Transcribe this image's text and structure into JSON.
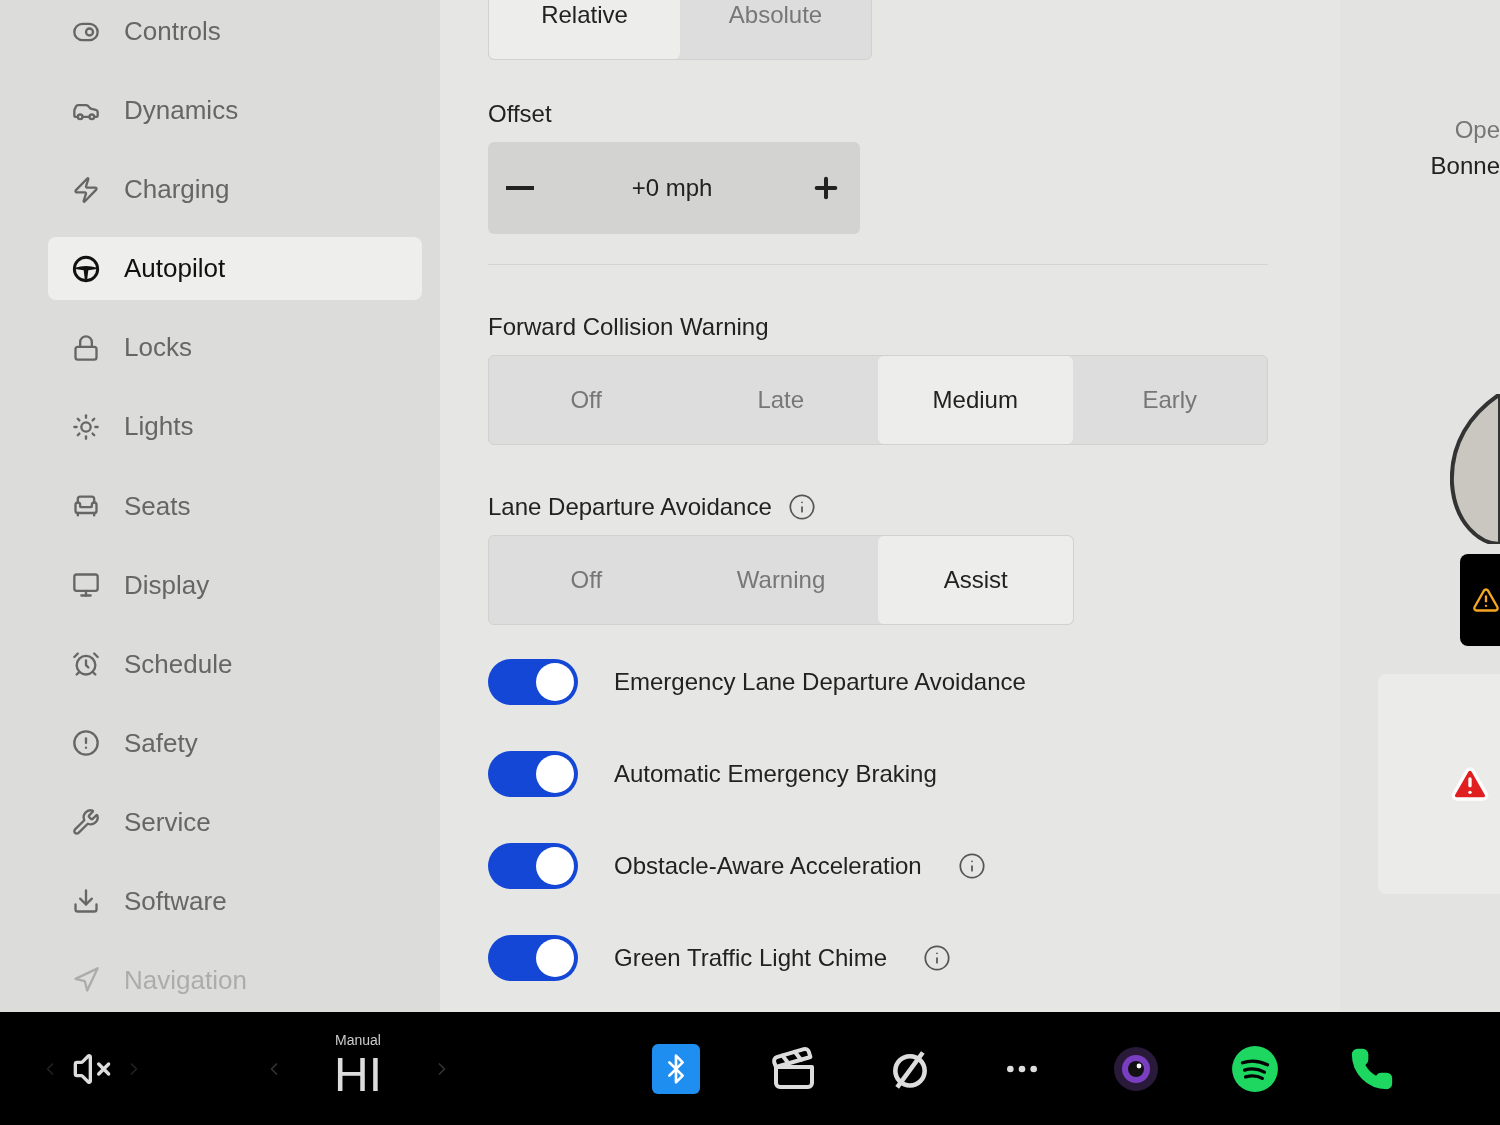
{
  "sidebar": {
    "items": [
      {
        "label": "Controls",
        "selected": false
      },
      {
        "label": "Dynamics",
        "selected": false
      },
      {
        "label": "Charging",
        "selected": false
      },
      {
        "label": "Autopilot",
        "selected": true
      },
      {
        "label": "Locks",
        "selected": false
      },
      {
        "label": "Lights",
        "selected": false
      },
      {
        "label": "Seats",
        "selected": false
      },
      {
        "label": "Display",
        "selected": false
      },
      {
        "label": "Schedule",
        "selected": false
      },
      {
        "label": "Safety",
        "selected": false
      },
      {
        "label": "Service",
        "selected": false
      },
      {
        "label": "Software",
        "selected": false
      },
      {
        "label": "Navigation",
        "selected": false
      }
    ]
  },
  "speed_mode": {
    "options": [
      {
        "label": "Relative",
        "selected": true
      },
      {
        "label": "Absolute",
        "selected": false
      }
    ]
  },
  "offset": {
    "title": "Offset",
    "value": "+0 mph"
  },
  "forward_collision_warning": {
    "title": "Forward Collision Warning",
    "info": false,
    "options": [
      {
        "label": "Off",
        "selected": false
      },
      {
        "label": "Late",
        "selected": false
      },
      {
        "label": "Medium",
        "selected": true
      },
      {
        "label": "Early",
        "selected": false
      }
    ]
  },
  "lane_departure_avoidance": {
    "title": "Lane Departure Avoidance",
    "info": true,
    "options": [
      {
        "label": "Off",
        "selected": false
      },
      {
        "label": "Warning",
        "selected": false
      },
      {
        "label": "Assist",
        "selected": true
      }
    ]
  },
  "toggles": [
    {
      "label": "Emergency Lane Departure Avoidance",
      "on": true,
      "info": false
    },
    {
      "label": "Automatic Emergency Braking",
      "on": true,
      "info": false
    },
    {
      "label": "Obstacle-Aware Acceleration",
      "on": true,
      "info": true
    },
    {
      "label": "Green Traffic Light Chime",
      "on": true,
      "info": true
    }
  ],
  "right_panel": {
    "line_1": "Ope",
    "line_2": "Bonne"
  },
  "taskbar": {
    "climate_mode": "Manual",
    "temperature": "HI",
    "muted": true
  }
}
